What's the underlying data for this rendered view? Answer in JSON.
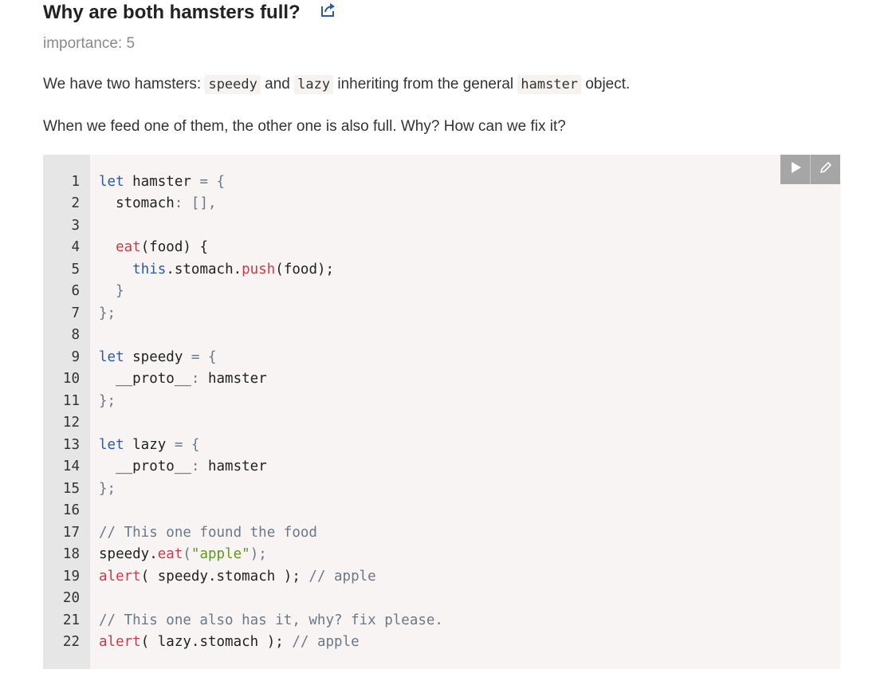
{
  "task": {
    "title": "Why are both hamsters full?",
    "importance_label": "importance: 5",
    "para1": {
      "t1": "We have two hamsters: ",
      "c1": "speedy",
      "t2": " and ",
      "c2": "lazy",
      "t3": " inheriting from the general ",
      "c3": "hamster",
      "t4": " object."
    },
    "para2": "When we feed one of them, the other one is also full. Why? How can we fix it?"
  },
  "icons": {
    "share": "share-icon",
    "run": "play-icon",
    "edit": "pencil-icon"
  },
  "colors": {
    "keyword": "#2a5ba8",
    "function": "#c93a4a",
    "string": "#5a9a1a",
    "comment": "#6b7886",
    "code_bg": "#f7f4f3",
    "gutter_bg": "#e6e6e6",
    "toolbar_btn": "#a6a6a6"
  },
  "code": {
    "line_numbers": [
      "1",
      "2",
      "3",
      "4",
      "5",
      "6",
      "7",
      "8",
      "9",
      "10",
      "11",
      "12",
      "13",
      "14",
      "15",
      "16",
      "17",
      "18",
      "19",
      "20",
      "21",
      "22"
    ],
    "tokens": {
      "l1a": "let",
      "l1b": " hamster ",
      "l1c": "=",
      "l1d": " {",
      "l2a": "  stomach",
      "l2b": ":",
      "l2c": " [],",
      "l4a": "  ",
      "l4b": "eat",
      "l4c": "(food) {",
      "l5a": "    ",
      "l5b": "this",
      "l5c": ".stomach.",
      "l5d": "push",
      "l5e": "(food);",
      "l6a": "  }",
      "l7a": "};",
      "l9a": "let",
      "l9b": " speedy ",
      "l9c": "=",
      "l9d": " {",
      "l10a": "  __proto__",
      "l10b": ":",
      "l10c": " hamster",
      "l11a": "};",
      "l13a": "let",
      "l13b": " lazy ",
      "l13c": "=",
      "l13d": " {",
      "l14a": "  __proto__",
      "l14b": ":",
      "l14c": " hamster",
      "l15a": "};",
      "l17a": "// This one found the food",
      "l18a": "speedy.",
      "l18b": "eat",
      "l18c": "(",
      "l18d": "\"apple\"",
      "l18e": ");",
      "l19a": "alert",
      "l19b": "( speedy.stomach ); ",
      "l19c": "// apple",
      "l21a": "// This one also has it, why? fix please.",
      "l22a": "alert",
      "l22b": "( lazy.stomach ); ",
      "l22c": "// apple"
    }
  }
}
